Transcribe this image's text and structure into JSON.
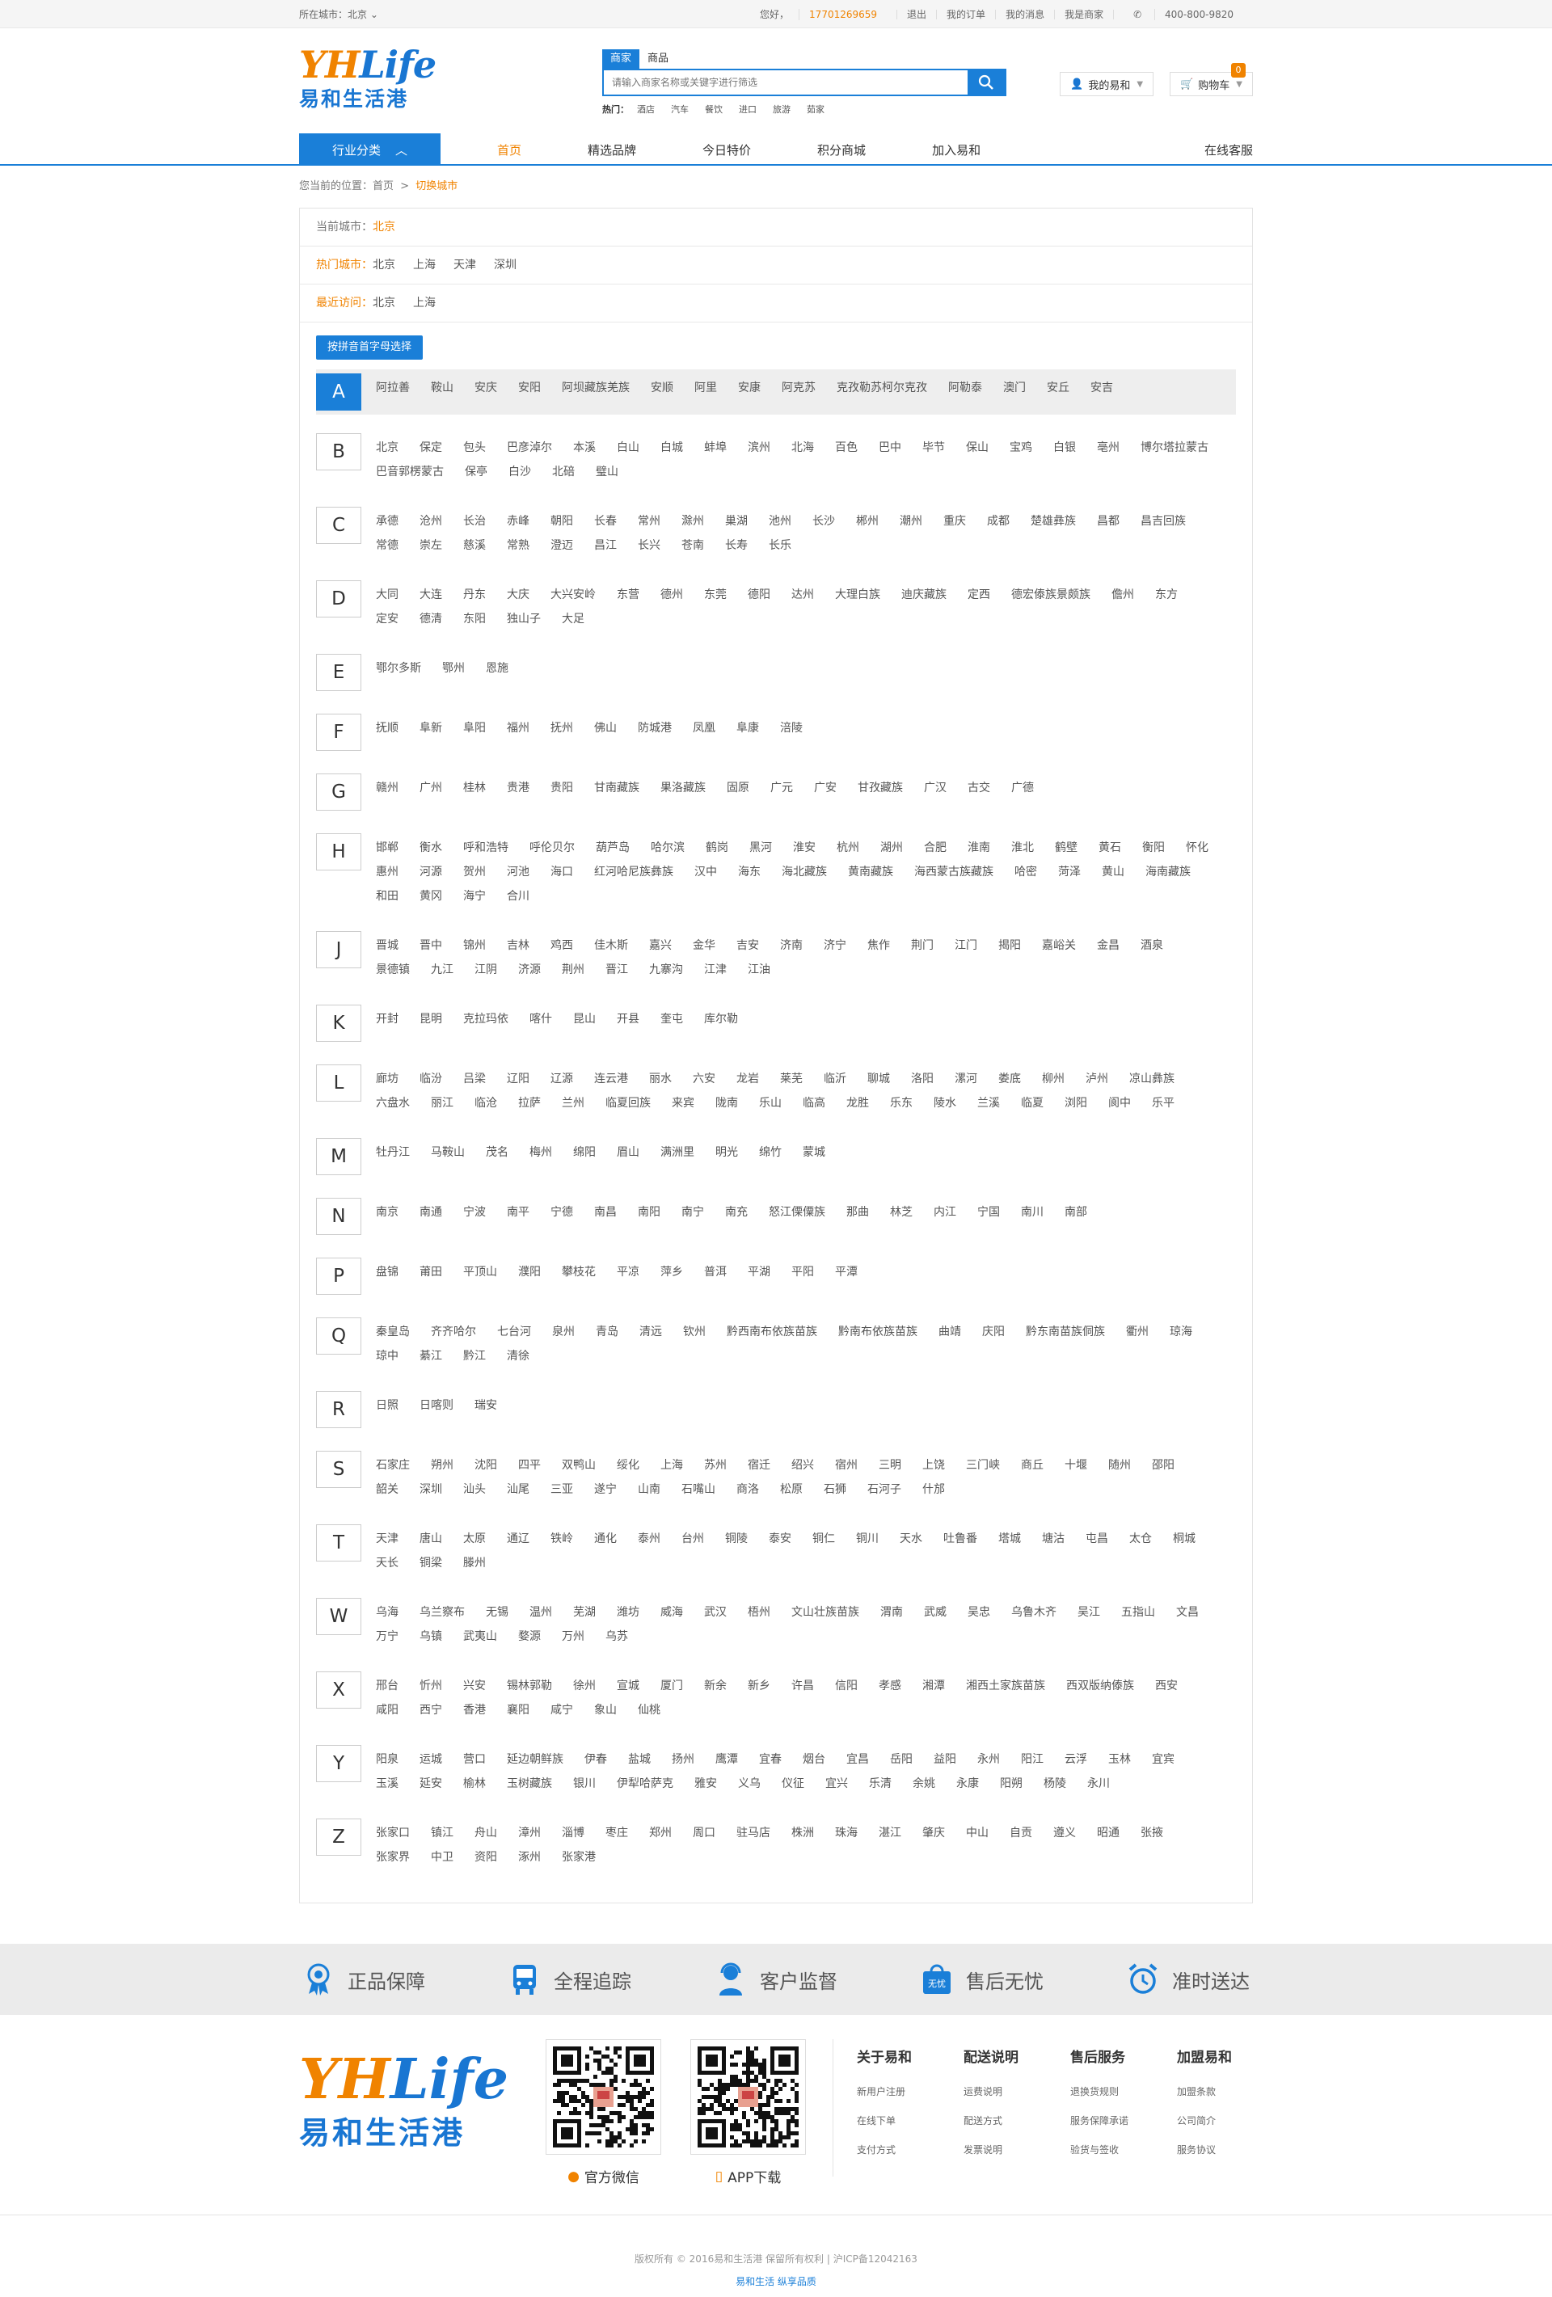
{
  "topbar": {
    "city_label": "所在城市：北京",
    "greeting": "您好，",
    "phone": "17701269659",
    "logout": "退出",
    "orders": "我的订单",
    "messages": "我的消息",
    "merchant": "我是商家",
    "hotline": "400-800-9820"
  },
  "header": {
    "logo_text": "YHLife",
    "logo_cn": "易和生活港",
    "search_tabs": [
      "商家",
      "商品"
    ],
    "search_placeholder": "请输入商家名称或关键字进行筛选",
    "hot_label": "热门：",
    "hot_items": [
      "酒店",
      "汽车",
      "餐饮",
      "进口",
      "旅游",
      "茹家"
    ],
    "account_label": "我的易和",
    "cart_label": "购物车",
    "cart_count": "0"
  },
  "nav": {
    "category": "行业分类",
    "links": [
      "首页",
      "精选品牌",
      "今日特价",
      "积分商城",
      "加入易和"
    ],
    "service": "在线客服"
  },
  "breadcrumb": {
    "prefix": "您当前的位置：",
    "home": "首页",
    "sep": ">",
    "current": "切换城市"
  },
  "city_select": {
    "current_label": "当前城市：",
    "current_city": "北京",
    "hot_label": "热门城市：",
    "hot_cities": [
      "北京",
      "上海",
      "天津",
      "深圳"
    ],
    "recent_label": "最近访问：",
    "recent_cities": [
      "北京",
      "上海"
    ],
    "pinyin_button": "按拼音首字母选择"
  },
  "letters": [
    {
      "letter": "A",
      "cities": [
        "阿拉善",
        "鞍山",
        "安庆",
        "安阳",
        "阿坝藏族羌族",
        "安顺",
        "阿里",
        "安康",
        "阿克苏",
        "克孜勒苏柯尔克孜",
        "阿勒泰",
        "澳门",
        "安丘",
        "安吉"
      ]
    },
    {
      "letter": "B",
      "cities": [
        "北京",
        "保定",
        "包头",
        "巴彦淖尔",
        "本溪",
        "白山",
        "白城",
        "蚌埠",
        "滨州",
        "北海",
        "百色",
        "巴中",
        "毕节",
        "保山",
        "宝鸡",
        "白银",
        "亳州",
        "博尔塔拉蒙古",
        "巴音郭楞蒙古",
        "保亭",
        "白沙",
        "北碚",
        "璧山"
      ]
    },
    {
      "letter": "C",
      "cities": [
        "承德",
        "沧州",
        "长治",
        "赤峰",
        "朝阳",
        "长春",
        "常州",
        "滁州",
        "巢湖",
        "池州",
        "长沙",
        "郴州",
        "潮州",
        "重庆",
        "成都",
        "楚雄彝族",
        "昌都",
        "昌吉回族",
        "常德",
        "崇左",
        "慈溪",
        "常熟",
        "澄迈",
        "昌江",
        "长兴",
        "苍南",
        "长寿",
        "长乐"
      ]
    },
    {
      "letter": "D",
      "cities": [
        "大同",
        "大连",
        "丹东",
        "大庆",
        "大兴安岭",
        "东营",
        "德州",
        "东莞",
        "德阳",
        "达州",
        "大理白族",
        "迪庆藏族",
        "定西",
        "德宏傣族景颇族",
        "儋州",
        "东方",
        "定安",
        "德清",
        "东阳",
        "独山子",
        "大足"
      ]
    },
    {
      "letter": "E",
      "cities": [
        "鄂尔多斯",
        "鄂州",
        "恩施"
      ]
    },
    {
      "letter": "F",
      "cities": [
        "抚顺",
        "阜新",
        "阜阳",
        "福州",
        "抚州",
        "佛山",
        "防城港",
        "凤凰",
        "阜康",
        "涪陵"
      ]
    },
    {
      "letter": "G",
      "cities": [
        "赣州",
        "广州",
        "桂林",
        "贵港",
        "贵阳",
        "甘南藏族",
        "果洛藏族",
        "固原",
        "广元",
        "广安",
        "甘孜藏族",
        "广汉",
        "古交",
        "广德"
      ]
    },
    {
      "letter": "H",
      "cities": [
        "邯郸",
        "衡水",
        "呼和浩特",
        "呼伦贝尔",
        "葫芦岛",
        "哈尔滨",
        "鹤岗",
        "黑河",
        "淮安",
        "杭州",
        "湖州",
        "合肥",
        "淮南",
        "淮北",
        "鹤壁",
        "黄石",
        "衡阳",
        "怀化",
        "惠州",
        "河源",
        "贺州",
        "河池",
        "海口",
        "红河哈尼族彝族",
        "汉中",
        "海东",
        "海北藏族",
        "黄南藏族",
        "海西蒙古族藏族",
        "哈密",
        "菏泽",
        "黄山",
        "海南藏族",
        "和田",
        "黄冈",
        "海宁",
        "合川"
      ]
    },
    {
      "letter": "J",
      "cities": [
        "晋城",
        "晋中",
        "锦州",
        "吉林",
        "鸡西",
        "佳木斯",
        "嘉兴",
        "金华",
        "吉安",
        "济南",
        "济宁",
        "焦作",
        "荆门",
        "江门",
        "揭阳",
        "嘉峪关",
        "金昌",
        "酒泉",
        "景德镇",
        "九江",
        "江阴",
        "济源",
        "荆州",
        "晋江",
        "九寨沟",
        "江津",
        "江油"
      ]
    },
    {
      "letter": "K",
      "cities": [
        "开封",
        "昆明",
        "克拉玛依",
        "喀什",
        "昆山",
        "开县",
        "奎屯",
        "库尔勒"
      ]
    },
    {
      "letter": "L",
      "cities": [
        "廊坊",
        "临汾",
        "吕梁",
        "辽阳",
        "辽源",
        "连云港",
        "丽水",
        "六安",
        "龙岩",
        "莱芜",
        "临沂",
        "聊城",
        "洛阳",
        "漯河",
        "娄底",
        "柳州",
        "泸州",
        "凉山彝族",
        "六盘水",
        "丽江",
        "临沧",
        "拉萨",
        "兰州",
        "临夏回族",
        "来宾",
        "陇南",
        "乐山",
        "临高",
        "龙胜",
        "乐东",
        "陵水",
        "兰溪",
        "临夏",
        "浏阳",
        "阆中",
        "乐平"
      ]
    },
    {
      "letter": "M",
      "cities": [
        "牡丹江",
        "马鞍山",
        "茂名",
        "梅州",
        "绵阳",
        "眉山",
        "满洲里",
        "明光",
        "绵竹",
        "蒙城"
      ]
    },
    {
      "letter": "N",
      "cities": [
        "南京",
        "南通",
        "宁波",
        "南平",
        "宁德",
        "南昌",
        "南阳",
        "南宁",
        "南充",
        "怒江傈僳族",
        "那曲",
        "林芝",
        "内江",
        "宁国",
        "南川",
        "南部"
      ]
    },
    {
      "letter": "P",
      "cities": [
        "盘锦",
        "莆田",
        "平顶山",
        "濮阳",
        "攀枝花",
        "平凉",
        "萍乡",
        "普洱",
        "平湖",
        "平阳",
        "平潭"
      ]
    },
    {
      "letter": "Q",
      "cities": [
        "秦皇岛",
        "齐齐哈尔",
        "七台河",
        "泉州",
        "青岛",
        "清远",
        "钦州",
        "黔西南布依族苗族",
        "黔南布依族苗族",
        "曲靖",
        "庆阳",
        "黔东南苗族侗族",
        "衢州",
        "琼海",
        "琼中",
        "綦江",
        "黔江",
        "清徐"
      ]
    },
    {
      "letter": "R",
      "cities": [
        "日照",
        "日喀则",
        "瑞安"
      ]
    },
    {
      "letter": "S",
      "cities": [
        "石家庄",
        "朔州",
        "沈阳",
        "四平",
        "双鸭山",
        "绥化",
        "上海",
        "苏州",
        "宿迁",
        "绍兴",
        "宿州",
        "三明",
        "上饶",
        "三门峡",
        "商丘",
        "十堰",
        "随州",
        "邵阳",
        "韶关",
        "深圳",
        "汕头",
        "汕尾",
        "三亚",
        "遂宁",
        "山南",
        "石嘴山",
        "商洛",
        "松原",
        "石狮",
        "石河子",
        "什邡"
      ]
    },
    {
      "letter": "T",
      "cities": [
        "天津",
        "唐山",
        "太原",
        "通辽",
        "铁岭",
        "通化",
        "泰州",
        "台州",
        "铜陵",
        "泰安",
        "铜仁",
        "铜川",
        "天水",
        "吐鲁番",
        "塔城",
        "塘沽",
        "屯昌",
        "太仓",
        "桐城",
        "天长",
        "铜梁",
        "滕州"
      ]
    },
    {
      "letter": "W",
      "cities": [
        "乌海",
        "乌兰察布",
        "无锡",
        "温州",
        "芜湖",
        "潍坊",
        "威海",
        "武汉",
        "梧州",
        "文山壮族苗族",
        "渭南",
        "武威",
        "吴忠",
        "乌鲁木齐",
        "吴江",
        "五指山",
        "文昌",
        "万宁",
        "乌镇",
        "武夷山",
        "婺源",
        "万州",
        "乌苏"
      ]
    },
    {
      "letter": "X",
      "cities": [
        "邢台",
        "忻州",
        "兴安",
        "锡林郭勒",
        "徐州",
        "宣城",
        "厦门",
        "新余",
        "新乡",
        "许昌",
        "信阳",
        "孝感",
        "湘潭",
        "湘西土家族苗族",
        "西双版纳傣族",
        "西安",
        "咸阳",
        "西宁",
        "香港",
        "襄阳",
        "咸宁",
        "象山",
        "仙桃"
      ]
    },
    {
      "letter": "Y",
      "cities": [
        "阳泉",
        "运城",
        "营口",
        "延边朝鲜族",
        "伊春",
        "盐城",
        "扬州",
        "鹰潭",
        "宜春",
        "烟台",
        "宜昌",
        "岳阳",
        "益阳",
        "永州",
        "阳江",
        "云浮",
        "玉林",
        "宜宾",
        "玉溪",
        "延安",
        "榆林",
        "玉树藏族",
        "银川",
        "伊犁哈萨克",
        "雅安",
        "义乌",
        "仪征",
        "宜兴",
        "乐清",
        "余姚",
        "永康",
        "阳朔",
        "杨陵",
        "永川"
      ]
    },
    {
      "letter": "Z",
      "cities": [
        "张家口",
        "镇江",
        "舟山",
        "漳州",
        "淄博",
        "枣庄",
        "郑州",
        "周口",
        "驻马店",
        "株洲",
        "珠海",
        "湛江",
        "肇庆",
        "中山",
        "自贡",
        "遵义",
        "昭通",
        "张掖",
        "张家界",
        "中卫",
        "资阳",
        "涿州",
        "张家港"
      ]
    }
  ],
  "features": [
    "正品保障",
    "全程追踪",
    "客户监督",
    "售后无忧",
    "准时送达"
  ],
  "feature_badge": "无忧",
  "footer": {
    "logo_text": "YHLife",
    "logo_cn": "易和生活港",
    "qr_wechat": "官方微信",
    "qr_app": "APP下载",
    "columns": [
      {
        "title": "关于易和",
        "items": [
          "新用户注册",
          "在线下单",
          "支付方式"
        ]
      },
      {
        "title": "配送说明",
        "items": [
          "运费说明",
          "配送方式",
          "发票说明"
        ]
      },
      {
        "title": "售后服务",
        "items": [
          "退换货规则",
          "服务保障承诺",
          "验货与签收"
        ]
      },
      {
        "title": "加盟易和",
        "items": [
          "加盟条款",
          "公司简介",
          "服务协议"
        ]
      }
    ],
    "copyright": "版权所有 © 2016易和生活港   保留所有权利 | 沪ICP备12042163",
    "slogan": "易和生活   纵享品质"
  },
  "colors": {
    "brand_blue": "#1a7fd8",
    "brand_orange": "#f08300"
  }
}
